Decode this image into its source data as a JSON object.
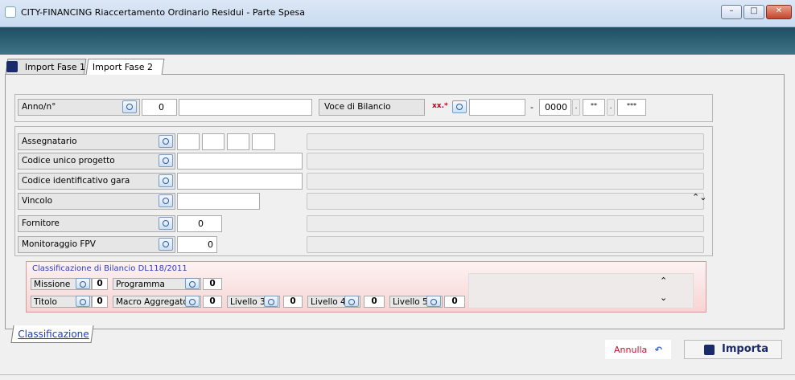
{
  "window": {
    "title": "CITY-FINANCING  Riaccertamento Ordinario Residui - Parte Spesa",
    "minimize": "–",
    "maximize": "□",
    "close": "✕"
  },
  "tabs": [
    {
      "label": "Import  Fase 1"
    },
    {
      "label": "Import  Fase 2"
    }
  ],
  "header": {
    "anno_label": "Anno/n°",
    "anno_value": "0",
    "anno_number": "",
    "voce_label": "Voce di Bilancio",
    "voce_prefix": "xx.*",
    "voce_value": "",
    "voce_sep": "-",
    "voce_code": "0000",
    "voce_dot1": ".",
    "voce_ast1": "**",
    "voce_dot2": ".",
    "voce_ast2": "***"
  },
  "fields": {
    "assegnatario": "Assegnatario",
    "cup": "Codice unico progetto",
    "cig": "Codice identificativo gara",
    "vincolo": "Vincolo",
    "fornitore": "Fornitore",
    "fornitore_value": "0",
    "monitoraggio": "Monitoraggio FPV",
    "monitoraggio_value": "0",
    "vincolo_spin": "⌃⌄"
  },
  "classificazione": {
    "title": "Classificazione di Bilancio DL118/2011",
    "missione": "Missione",
    "missione_value": "0",
    "programma": "Programma",
    "programma_value": "0",
    "titolo": "Titolo",
    "titolo_value": "0",
    "macro": "Macro Aggregato",
    "macro_value": "0",
    "livello3": "Livello 3",
    "livello3_value": "0",
    "livello4": "Livello 4",
    "livello4_value": "0",
    "livello5": "Livello 5",
    "livello5_value": "0",
    "scroll_up": "⌃",
    "scroll_down": "⌄"
  },
  "bottom": {
    "tab_label": "Classificazione",
    "annulla_label": "Annulla",
    "annulla_icon": "↶",
    "importa_label": "Importa"
  },
  "colors": {
    "band": "#2a5c70",
    "classificazione_bg": "#f7d4d4",
    "link_blue": "#1a3cc8"
  }
}
